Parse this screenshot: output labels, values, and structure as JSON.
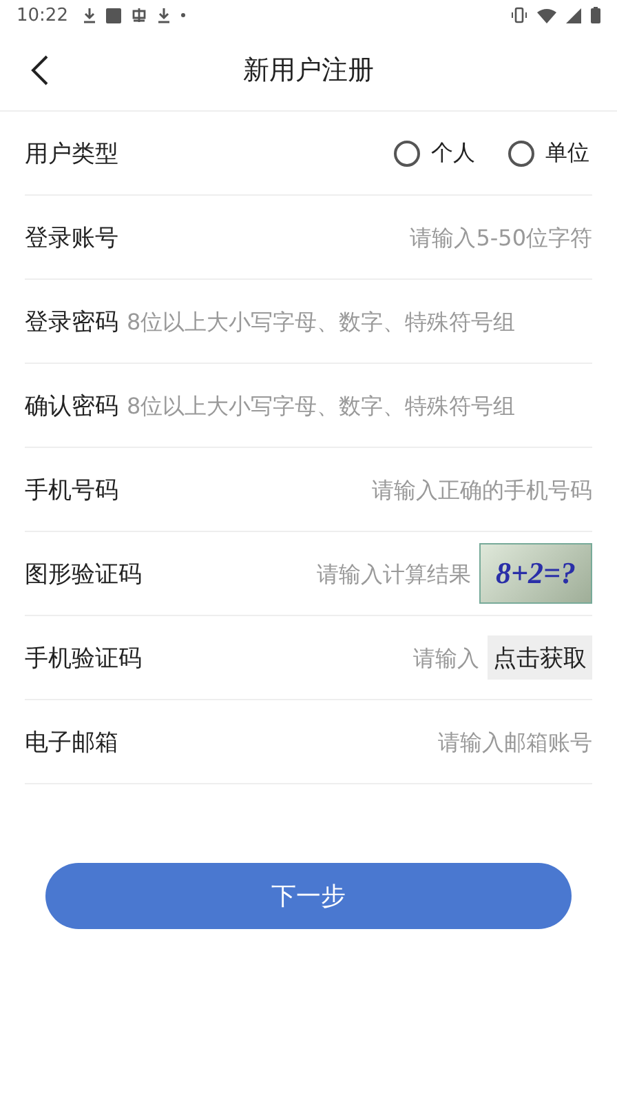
{
  "status_bar": {
    "time": "10:22"
  },
  "header": {
    "title": "新用户注册"
  },
  "fields": [
    {
      "kind": "radio",
      "label": "用户类型",
      "options": [
        {
          "label": "个人",
          "selected": false
        },
        {
          "label": "单位",
          "selected": false
        }
      ]
    },
    {
      "kind": "input",
      "label": "登录账号",
      "placeholder": "请输入5-50位字符"
    },
    {
      "kind": "password",
      "label": "登录密码",
      "placeholder": "8位以上大小写字母、数字、特殊符号组"
    },
    {
      "kind": "password",
      "label": "确认密码",
      "placeholder": "8位以上大小写字母、数字、特殊符号组"
    },
    {
      "kind": "input",
      "label": "手机号码",
      "placeholder": "请输入正确的手机号码"
    },
    {
      "kind": "captcha",
      "label": "图形验证码",
      "placeholder": "请输入计算结果",
      "captcha": "8+2=?"
    },
    {
      "kind": "sms",
      "label": "手机验证码",
      "placeholder": "请输入",
      "button": "点击获取"
    },
    {
      "kind": "input",
      "label": "电子邮箱",
      "placeholder": "请输入邮箱账号"
    }
  ],
  "next_button": "下一步"
}
